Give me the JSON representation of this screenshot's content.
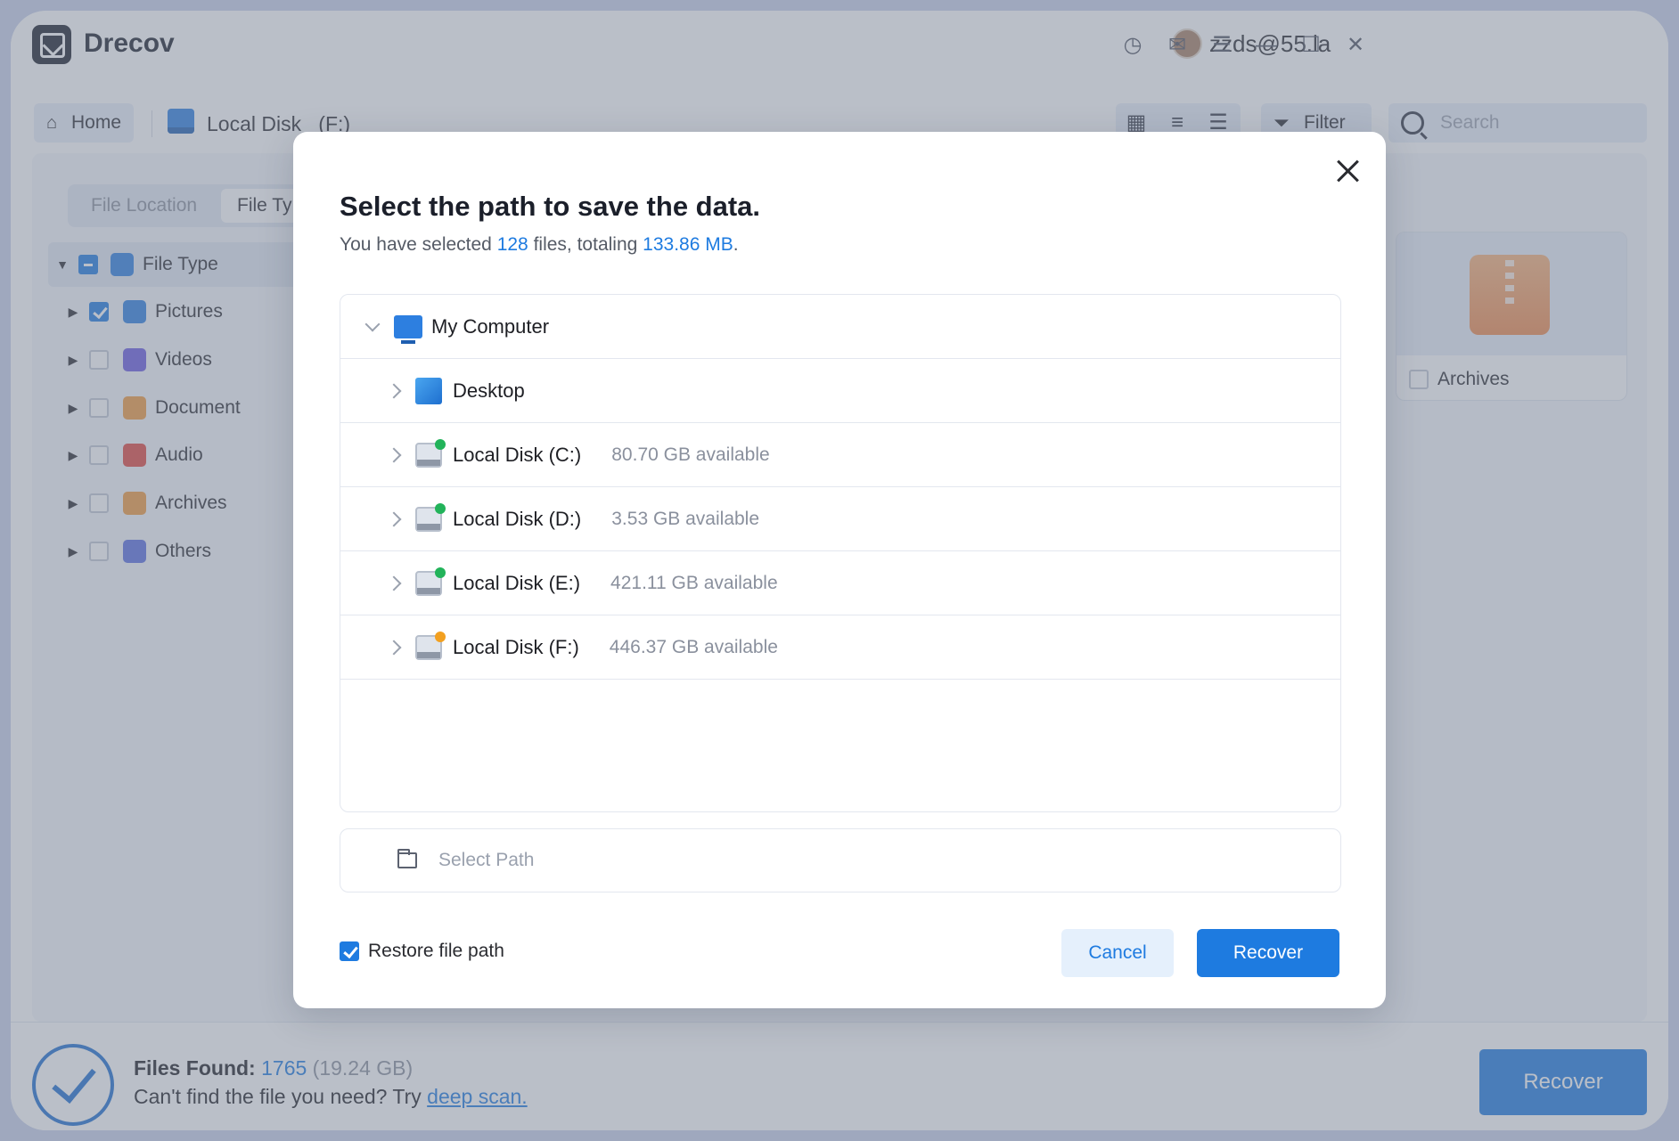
{
  "app": {
    "title": "Drecov",
    "user_email": "zzds@55.la"
  },
  "titlebar_icons": [
    "history-icon",
    "mail-icon",
    "menu-icon",
    "minimize-icon",
    "maximize-icon",
    "close-icon"
  ],
  "toolbar": {
    "home_label": "Home",
    "breadcrumb_disk": "Local Disk",
    "breadcrumb_drive": "(F:)",
    "filter_label": "Filter",
    "search_placeholder": "Search"
  },
  "tabs": [
    {
      "label": "File Location",
      "active": false
    },
    {
      "label": "File Ty",
      "active": true
    }
  ],
  "tree": {
    "root": {
      "label": "File Type",
      "state": "partial"
    },
    "items": [
      {
        "label": "Pictures",
        "checked": true,
        "icon": "pictures-icon",
        "color": "#2d7fe0"
      },
      {
        "label": "Videos",
        "checked": false,
        "icon": "videos-icon",
        "color": "#6a5ae0"
      },
      {
        "label": "Document",
        "checked": false,
        "icon": "document-icon",
        "color": "#f09a3e"
      },
      {
        "label": "Audio",
        "checked": false,
        "icon": "audio-icon",
        "color": "#e0473f"
      },
      {
        "label": "Archives",
        "checked": false,
        "icon": "archives-icon",
        "color": "#f09a3e"
      },
      {
        "label": "Others",
        "checked": false,
        "icon": "others-icon",
        "color": "#5a6ee0"
      }
    ]
  },
  "card": {
    "label": "Archives",
    "checked": false
  },
  "bottom": {
    "found_label": "Files Found:",
    "found_count": "1765",
    "found_size": "(19.24 GB)",
    "hint_text": "Can't find the file you need? Try ",
    "hint_link": "deep scan.",
    "recover_label": "Recover"
  },
  "dialog": {
    "title": "Select the path to save the data.",
    "sub_prefix": "You have selected ",
    "sub_count": "128",
    "sub_mid": " files, totaling ",
    "sub_size": "133.86 MB",
    "sub_suffix": ".",
    "root_label": "My Computer",
    "locations": [
      {
        "label": "Desktop",
        "available": ""
      },
      {
        "label": "Local Disk (C:)",
        "available": "80.70 GB available",
        "badge_color": "#22b35a"
      },
      {
        "label": "Local Disk (D:)",
        "available": "3.53 GB available",
        "badge_color": "#22b35a"
      },
      {
        "label": "Local Disk (E:)",
        "available": "421.11 GB available",
        "badge_color": "#22b35a"
      },
      {
        "label": "Local Disk (F:)",
        "available": "446.37 GB available",
        "badge_color": "#f2a020"
      }
    ],
    "select_path_placeholder": "Select Path",
    "restore_label": "Restore file path",
    "restore_checked": true,
    "cancel_label": "Cancel",
    "recover_label": "Recover"
  },
  "colors": {
    "accent": "#1e7be0",
    "overlay": "rgba(118,128,146,0.5)"
  }
}
